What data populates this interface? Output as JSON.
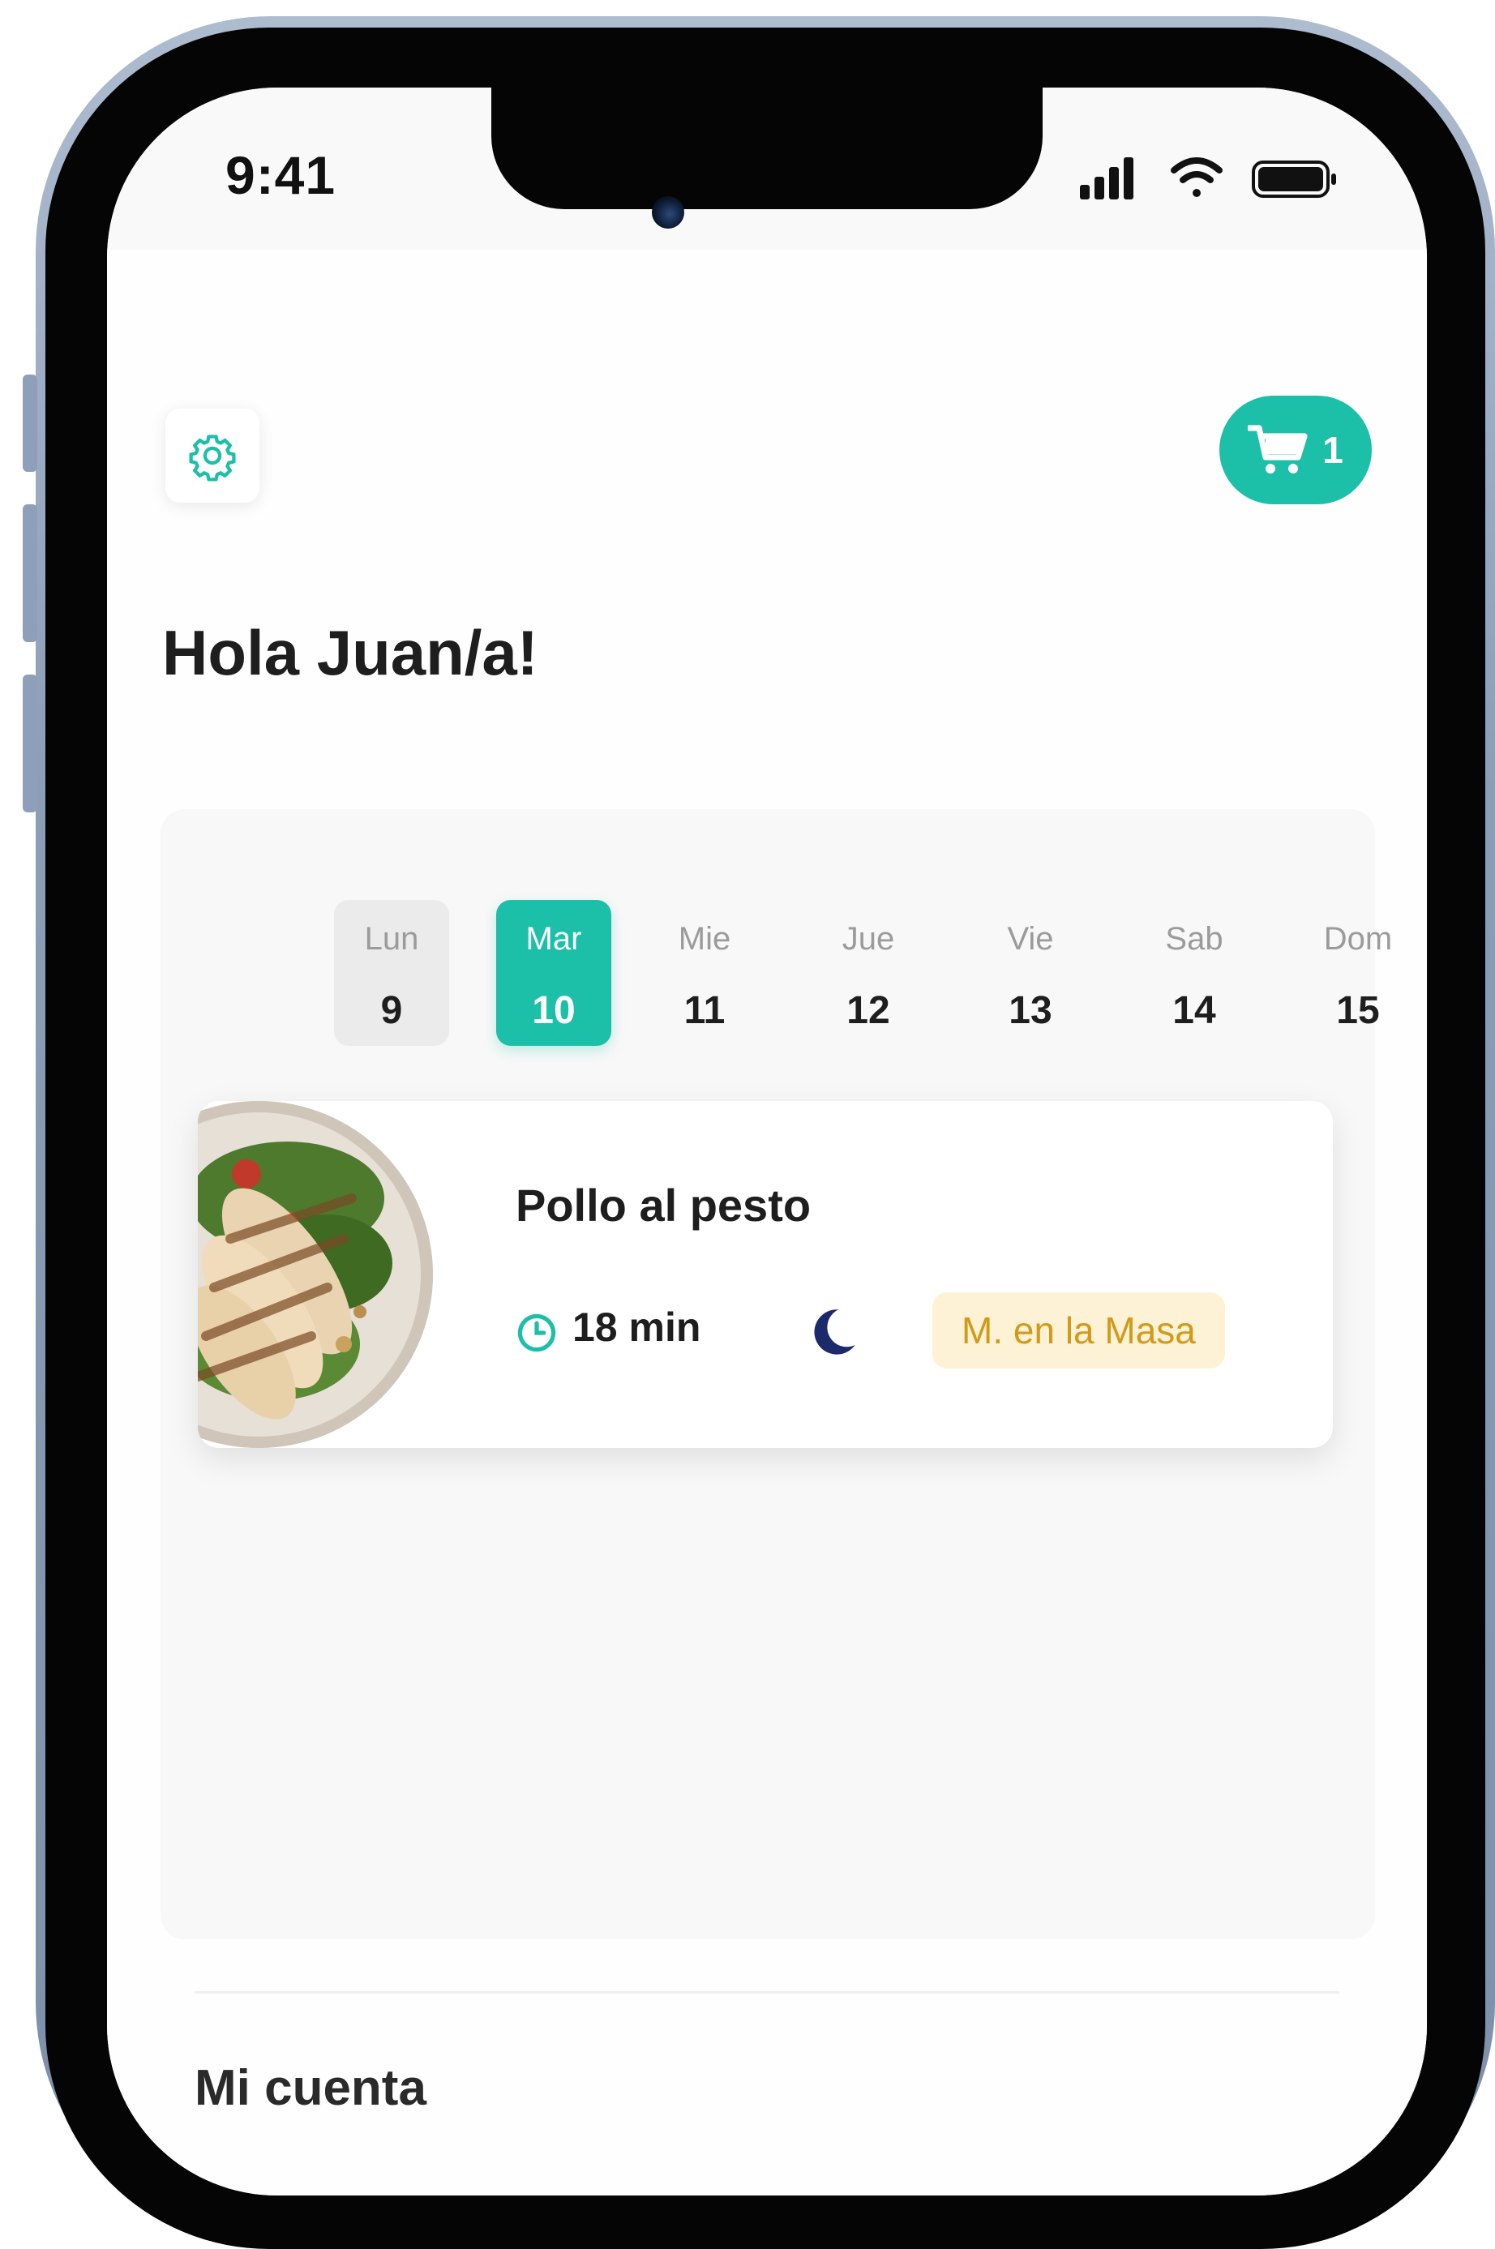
{
  "status_bar": {
    "time": "9:41",
    "icons": [
      "signal-icon",
      "wifi-icon",
      "battery-icon"
    ]
  },
  "header": {
    "settings_icon": "gear-icon",
    "cart_icon": "cart-icon",
    "cart_count": "1"
  },
  "greeting": "Hola Juan/a!",
  "week": {
    "days": [
      {
        "name": "Lun",
        "number": "9",
        "state": "muted"
      },
      {
        "name": "Mar",
        "number": "10",
        "state": "active"
      },
      {
        "name": "Mie",
        "number": "11",
        "state": "default"
      },
      {
        "name": "Jue",
        "number": "12",
        "state": "default"
      },
      {
        "name": "Vie",
        "number": "13",
        "state": "default"
      },
      {
        "name": "Sab",
        "number": "14",
        "state": "default"
      },
      {
        "name": "Dom",
        "number": "15",
        "state": "default"
      }
    ]
  },
  "recipe": {
    "title": "Pollo al pesto",
    "time": "18 min",
    "time_icon": "clock-icon",
    "meal_icon": "moon-icon",
    "badge": "M. en la Masa"
  },
  "account": {
    "title": "Mi cuenta"
  },
  "colors": {
    "accent": "#1cbfa8",
    "badge_bg": "#fdf2d6",
    "badge_text": "#d19a19",
    "moon": "#1c2a6b"
  }
}
